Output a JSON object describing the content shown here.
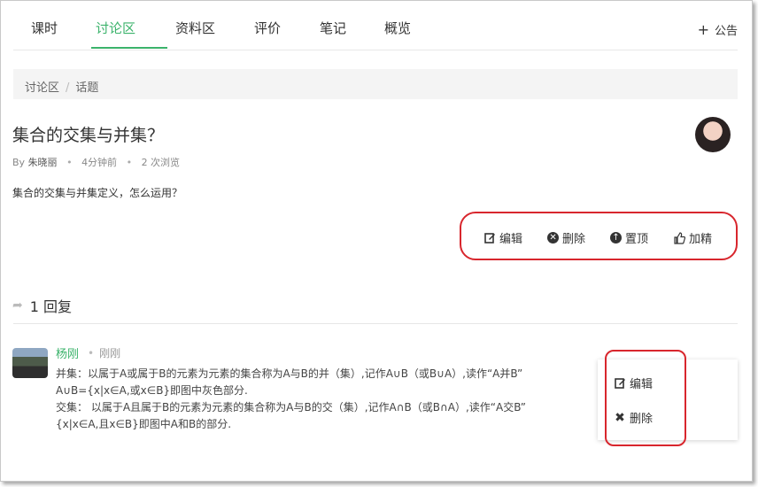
{
  "tabs": [
    {
      "label": "课时"
    },
    {
      "label": "讨论区"
    },
    {
      "label": "资料区"
    },
    {
      "label": "评价"
    },
    {
      "label": "笔记"
    },
    {
      "label": "概览"
    }
  ],
  "notice": {
    "icon": "plus-icon",
    "label": "公告"
  },
  "breadcrumb": {
    "root": "讨论区",
    "separator": "/",
    "current": "话题"
  },
  "topic": {
    "title": "集合的交集与并集？",
    "by_label": "By",
    "author": "朱晓丽",
    "time": "4分钟前",
    "views": "2 次浏览",
    "content": "集合的交集与并集定义，怎么运用？",
    "actions": [
      {
        "icon": "edit-icon",
        "label": "编辑"
      },
      {
        "icon": "delete-icon",
        "label": "删除"
      },
      {
        "icon": "pin-top-icon",
        "label": "置顶"
      },
      {
        "icon": "thumbs-up-icon",
        "label": "加精"
      }
    ]
  },
  "replies_header": {
    "count_label": "1 回复"
  },
  "reply": {
    "name": "杨刚",
    "time": "刚刚",
    "lines": [
      "并集：以属于A或属于B的元素为元素的集合称为A与B的并（集）,记作A∪B（或B∪A）,读作“A并B”",
      "A∪B={x|x∈A,或x∈B}即图中灰色部分.",
      "交集： 以属于A且属于B的元素为元素的集合称为A与B的交（集）,记作A∩B（或B∩A）,读作“A交B”",
      "{x|x∈A,且x∈B}即图中A和B的部分."
    ]
  },
  "reply_menu": [
    {
      "icon": "edit-icon",
      "label": "编辑"
    },
    {
      "icon": "close-icon",
      "label": "删除"
    }
  ],
  "colors": {
    "accent": "#3bb36b",
    "highlight": "#d8262d"
  }
}
